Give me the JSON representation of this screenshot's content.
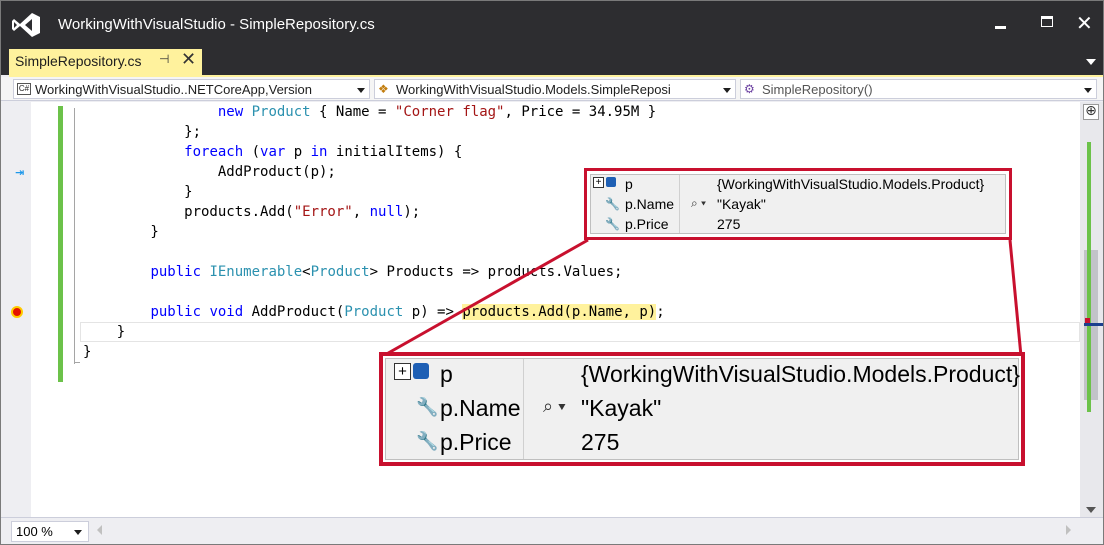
{
  "window": {
    "title": "WorkingWithVisualStudio - SimpleRepository.cs",
    "logo_icon": "visual-studio-logo",
    "controls": {
      "minimize_icon": "minimize-icon",
      "maximize_icon": "maximize-icon",
      "close_glyph": "✕"
    }
  },
  "tabs": [
    {
      "label": "SimpleRepository.cs",
      "pin_glyph": "⊣",
      "close_glyph": "✕",
      "active": true
    }
  ],
  "colors": {
    "accent_tab": "#fff29d",
    "titlebar": "#2d2d30",
    "highlight_border": "#c8102e",
    "change_bar": "#6cc24a",
    "keyword": "#0000ff",
    "type": "#2b91af",
    "string": "#a31515"
  },
  "navbar": {
    "project": {
      "icon": "csharp-project-icon",
      "icon_glyph": "C#",
      "label": "WorkingWithVisualStudio..NETCoreApp,Version"
    },
    "class": {
      "icon": "class-icon",
      "icon_glyph": "❖",
      "label": "WorkingWithVisualStudio.Models.SimpleReposi"
    },
    "member": {
      "icon": "method-icon",
      "icon_glyph": "⚙",
      "label": "SimpleRepository()"
    }
  },
  "code_lines": [
    [
      {
        "t": "                "
      },
      {
        "t": "new",
        "c": "kw"
      },
      {
        "t": " "
      },
      {
        "t": "Product",
        "c": "ty"
      },
      {
        "t": " { Name = "
      },
      {
        "t": "\"Corner flag\"",
        "c": "st"
      },
      {
        "t": ", Price = 34.95M }"
      }
    ],
    [
      {
        "t": "            };"
      }
    ],
    [
      {
        "t": "            "
      },
      {
        "t": "foreach",
        "c": "kw"
      },
      {
        "t": " ("
      },
      {
        "t": "var",
        "c": "kw"
      },
      {
        "t": " p "
      },
      {
        "t": "in",
        "c": "kw"
      },
      {
        "t": " initialItems) {"
      }
    ],
    [
      {
        "t": "                AddProduct(p);"
      }
    ],
    [
      {
        "t": "            }"
      }
    ],
    [
      {
        "t": "            products.Add("
      },
      {
        "t": "\"Error\"",
        "c": "st"
      },
      {
        "t": ", "
      },
      {
        "t": "null",
        "c": "kw"
      },
      {
        "t": ");"
      }
    ],
    [
      {
        "t": "        }"
      }
    ],
    [
      {
        "t": ""
      }
    ],
    [
      {
        "t": "        "
      },
      {
        "t": "public",
        "c": "kw"
      },
      {
        "t": " "
      },
      {
        "t": "IEnumerable",
        "c": "ty"
      },
      {
        "t": "<"
      },
      {
        "t": "Product",
        "c": "ty"
      },
      {
        "t": "> Products => products.Values;"
      }
    ],
    [
      {
        "t": ""
      }
    ],
    [
      {
        "t": "        "
      },
      {
        "t": "public",
        "c": "kw"
      },
      {
        "t": " "
      },
      {
        "t": "void",
        "c": "kw"
      },
      {
        "t": " AddProduct("
      },
      {
        "t": "Product",
        "c": "ty"
      },
      {
        "t": " p) => "
      },
      {
        "t": "products.Add(p.Name, p)",
        "c": "hl"
      },
      {
        "t": ";"
      }
    ],
    [
      {
        "t": "    }"
      }
    ],
    [
      {
        "t": "}"
      }
    ]
  ],
  "datatip": {
    "rows": [
      {
        "name": "p",
        "value": "{WorkingWithVisualStudio.Models.Product}",
        "icon": "expand-object-icon",
        "expander_glyph": "+"
      },
      {
        "name": "p.Name",
        "value": "\"Kayak\"",
        "icon": "wrench-property-icon",
        "icon_glyph": "🔧",
        "magnifier_glyph": "⌕ ▾"
      },
      {
        "name": "p.Price",
        "value": "275",
        "icon": "wrench-property-icon",
        "icon_glyph": "🔧"
      }
    ]
  },
  "statusbar": {
    "zoom": "100 %"
  }
}
